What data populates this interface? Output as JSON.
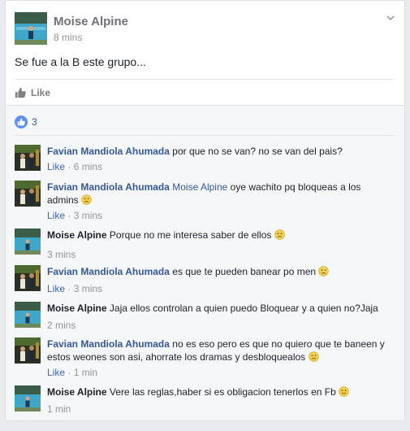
{
  "post": {
    "author": "Moise Alpine",
    "time": "8 mins",
    "text": "Se fue a la B este grupo...",
    "like_label": "Like",
    "reaction_count": "3"
  },
  "comments": [
    {
      "author": "Favian Mandiola Ahumada",
      "text": "por que no se van? no se van del pais?",
      "like": "Like",
      "dot": "·",
      "time": "6 mins"
    },
    {
      "author": "Favian Mandiola Ahumada",
      "mention": "Moise Alpine",
      "text": "oye wachito pq bloqueas a los admins",
      "like": "Like",
      "dot": "·",
      "time": "3 mins"
    },
    {
      "author": "Moise Alpine",
      "text": "Porque no me interesa saber de ellos",
      "time": "3 mins"
    },
    {
      "author": "Favian Mandiola Ahumada",
      "text": "es que te pueden banear po men",
      "like": "Like",
      "dot": "·",
      "time": "3 mins"
    },
    {
      "author": "Moise Alpine",
      "text": "Jaja ellos controlan a quien puedo Bloquear y a quien no?Jaja",
      "time": "2 mins"
    },
    {
      "author": "Favian Mandiola Ahumada",
      "text": "no es eso pero es que no quiero que te baneen y estos weones son asi, ahorrate los dramas y desbloquealos",
      "like": "Like",
      "dot": "·",
      "time": "1 min"
    },
    {
      "author": "Moise Alpine",
      "text": "Vere las reglas,haber si es obligacion tenerlos en Fb",
      "time": "1 min"
    }
  ]
}
